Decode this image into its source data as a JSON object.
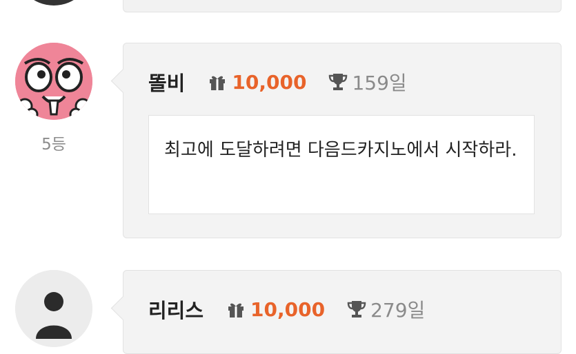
{
  "entries": [
    {
      "nickname": "똘비",
      "points": "10,000",
      "days": "159일",
      "rank": "5등",
      "message": "최고에 도달하려면 다음드카지노에서 시작하라."
    },
    {
      "nickname": "리리스",
      "points": "10,000",
      "days": "279일"
    }
  ],
  "colors": {
    "accent": "#e8632a",
    "card_bg": "#f3f3f3",
    "muted": "#8a8a8a"
  },
  "icons": [
    "gift-icon",
    "trophy-icon",
    "user-icon"
  ]
}
